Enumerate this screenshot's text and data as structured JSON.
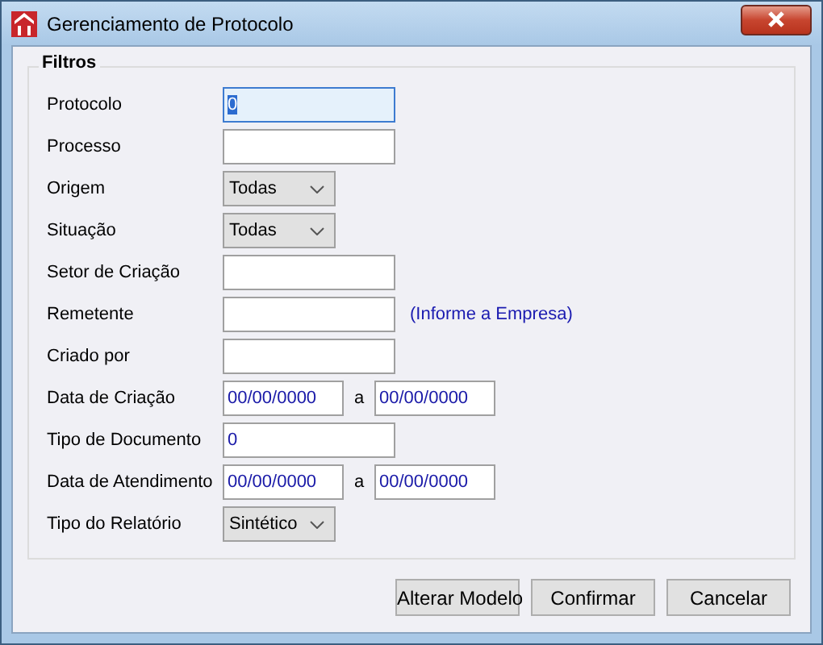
{
  "window": {
    "title": "Gerenciamento de Protocolo"
  },
  "filters": {
    "title": "Filtros",
    "rows": [
      {
        "kind": "text",
        "label": "Protocolo",
        "value": "0",
        "focused": true
      },
      {
        "kind": "text",
        "label": "Processo",
        "focused": false
      },
      {
        "kind": "select",
        "label": "Origem",
        "value": "Todas"
      },
      {
        "kind": "select",
        "label": "Situação",
        "value": "Todas"
      },
      {
        "kind": "text",
        "label": "Setor de Criação",
        "focused": false
      },
      {
        "kind": "text",
        "label": "Remetente",
        "focused": false,
        "hint": "(Informe a Empresa)"
      },
      {
        "kind": "text",
        "label": "Criado por",
        "focused": false
      },
      {
        "kind": "daterange",
        "label": "Data de Criação",
        "from": "00/00/0000",
        "separator": "a",
        "to": "00/00/0000"
      },
      {
        "kind": "text",
        "label": "Tipo de Documento",
        "value": "0",
        "focused": false
      },
      {
        "kind": "daterange",
        "label": "Data de Atendimento",
        "from": "00/00/0000",
        "separator": "a",
        "to": "00/00/0000"
      },
      {
        "kind": "select",
        "label": "Tipo do Relatório",
        "value": "Sintético"
      }
    ]
  },
  "buttons": [
    "Alterar Modelo",
    "Confirmar",
    "Cancelar"
  ]
}
